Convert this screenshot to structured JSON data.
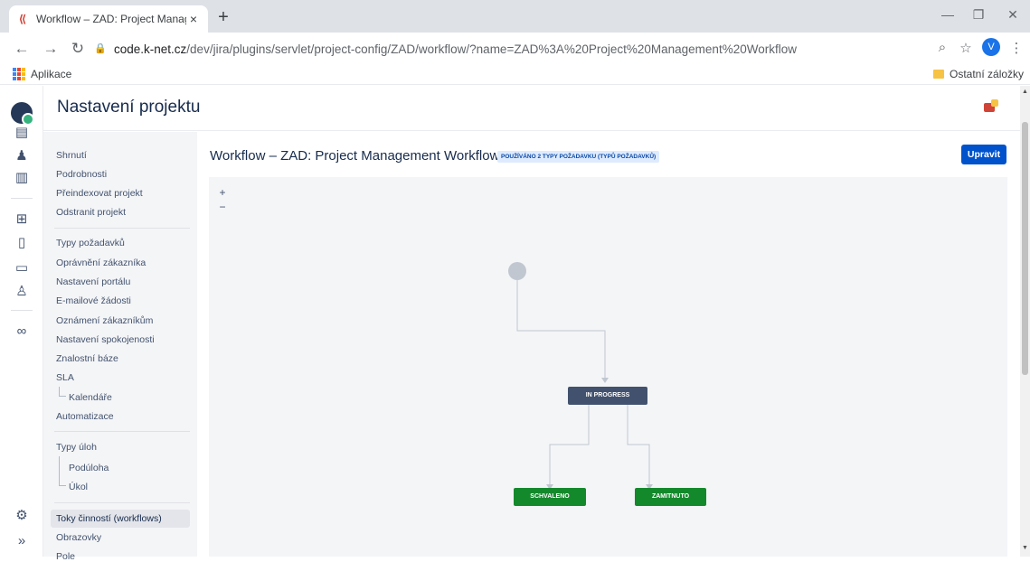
{
  "browser": {
    "tab_title": "Workflow – ZAD: Project Manag",
    "tab_close": "×",
    "new_tab": "+",
    "url_host": "code.k-net.cz",
    "url_path": "/dev/jira/plugins/servlet/project-config/ZAD/workflow/?name=ZAD%3A%20Project%20Management%20Workflow",
    "avatar_letter": "V",
    "bookmarks": {
      "apps_label": "Aplikace",
      "other_label": "Ostatní záložky"
    }
  },
  "page": {
    "title": "Nastavení projektu"
  },
  "sidebar": {
    "group1": [
      "Shrnutí",
      "Podrobnosti",
      "Přeindexovat projekt",
      "Odstranit projekt"
    ],
    "group2": [
      "Typy požadavků",
      "Oprávnění zákazníka",
      "Nastavení portálu",
      "E-mailové žádosti",
      "Oznámení zákazníkům",
      "Nastavení spokojenosti",
      "Znalostní báze",
      "SLA"
    ],
    "sla_child": "Kalendáře",
    "automation": "Automatizace",
    "group3_title": "Typy úloh",
    "group3_children": [
      "Podúloha",
      "Úkol"
    ],
    "group4": [
      "Toky činností (workflows)",
      "Obrazovky",
      "Pole"
    ]
  },
  "workflow": {
    "title": "Workflow – ZAD: Project Management Workflow",
    "usage_badge": "POUŽÍVÁNO 2 TYPY POŽADAVKU (TYPŮ POŽADAVKŮ)",
    "edit_label": "Upravit",
    "zoom_in": "+",
    "zoom_out": "−",
    "nodes": {
      "in_progress": "IN PROGRESS",
      "approved": "SCHVALENO",
      "rejected": "ZAMITNUTO"
    }
  },
  "colors": {
    "primary_button": "#0052cc",
    "status_in_progress": "#42526e",
    "status_done": "#14892c",
    "badge_bg": "#deebff"
  },
  "icons": {
    "rail": [
      "jira-service-desk-logo-icon",
      "queues-icon",
      "customers-icon",
      "reports-icon",
      "raise-request-icon",
      "knowledge-base-icon",
      "channels-icon",
      "invite-team-icon",
      "shortcut-link-icon",
      "settings-gear-icon",
      "expand-sidebar-icon"
    ]
  }
}
